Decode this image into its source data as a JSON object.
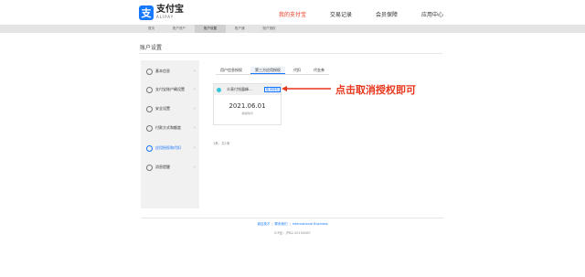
{
  "brand": {
    "mark": "支",
    "name_cn": "支付宝",
    "name_en": "ALIPAY"
  },
  "topnav": [
    "我的支付宝",
    "交易记录",
    "会员保障",
    "应用中心"
  ],
  "subnav": [
    {
      "label": "首页",
      "active": false
    },
    {
      "label": "账户资产",
      "active": false
    },
    {
      "label": "账户设置",
      "active": true
    },
    {
      "label": "账户通",
      "active": false
    },
    {
      "label": "账户授权",
      "active": false
    }
  ],
  "page_title": "账户设置",
  "sidebar": [
    {
      "label": "基本信息",
      "active": false
    },
    {
      "label": "支付宝账户确设置",
      "active": false
    },
    {
      "label": "安全设置",
      "active": false
    },
    {
      "label": "付款方式和额度",
      "active": false
    },
    {
      "label": "应用授权和代扣",
      "active": true
    },
    {
      "label": "消息提醒",
      "active": false
    }
  ],
  "tabs": [
    {
      "label": "用户信息授权",
      "active": false
    },
    {
      "label": "第三方应用授权",
      "active": true
    },
    {
      "label": "代扣",
      "active": false
    },
    {
      "label": "代金券",
      "active": false
    }
  ],
  "auth_card": {
    "app_name": "众青付钱露峰...",
    "cancel_label": "取消授权",
    "date": "2021.06.01",
    "date_caption": "授权时间"
  },
  "annotation": "点击取消授权即可",
  "pager": "1条，共1条",
  "footer": {
    "links": [
      "诚征英才",
      "联系我们",
      "International Business"
    ],
    "copyright": "ICP证：沪B2-20150087"
  },
  "colors": {
    "accent": "#1677ff",
    "annotation": "#e8371d"
  }
}
